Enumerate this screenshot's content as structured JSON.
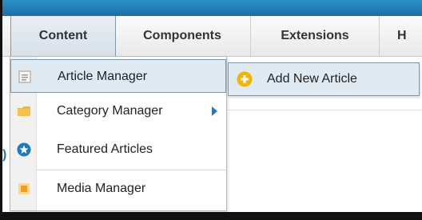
{
  "menubar": {
    "items": [
      {
        "label": "Content"
      },
      {
        "label": "Components"
      },
      {
        "label": "Extensions"
      },
      {
        "label": "H"
      }
    ]
  },
  "content_menu": {
    "items": [
      {
        "label": "Article Manager",
        "icon": "article-icon"
      },
      {
        "label": "Category Manager",
        "icon": "folder-icon"
      },
      {
        "label": "Featured Articles",
        "icon": "star-icon"
      },
      {
        "label": "Media Manager",
        "icon": "media-icon"
      }
    ]
  },
  "submenu": {
    "items": [
      {
        "label": "Add New Article",
        "icon": "add-icon"
      }
    ]
  },
  "background": {
    "edge_glyph": ")"
  },
  "colors": {
    "topbar": "#1a6fa6",
    "highlight": "#dfeaf3",
    "highlight_border": "#7b98b3",
    "add_icon": "#f4b400",
    "star_icon": "#1e78c2"
  }
}
